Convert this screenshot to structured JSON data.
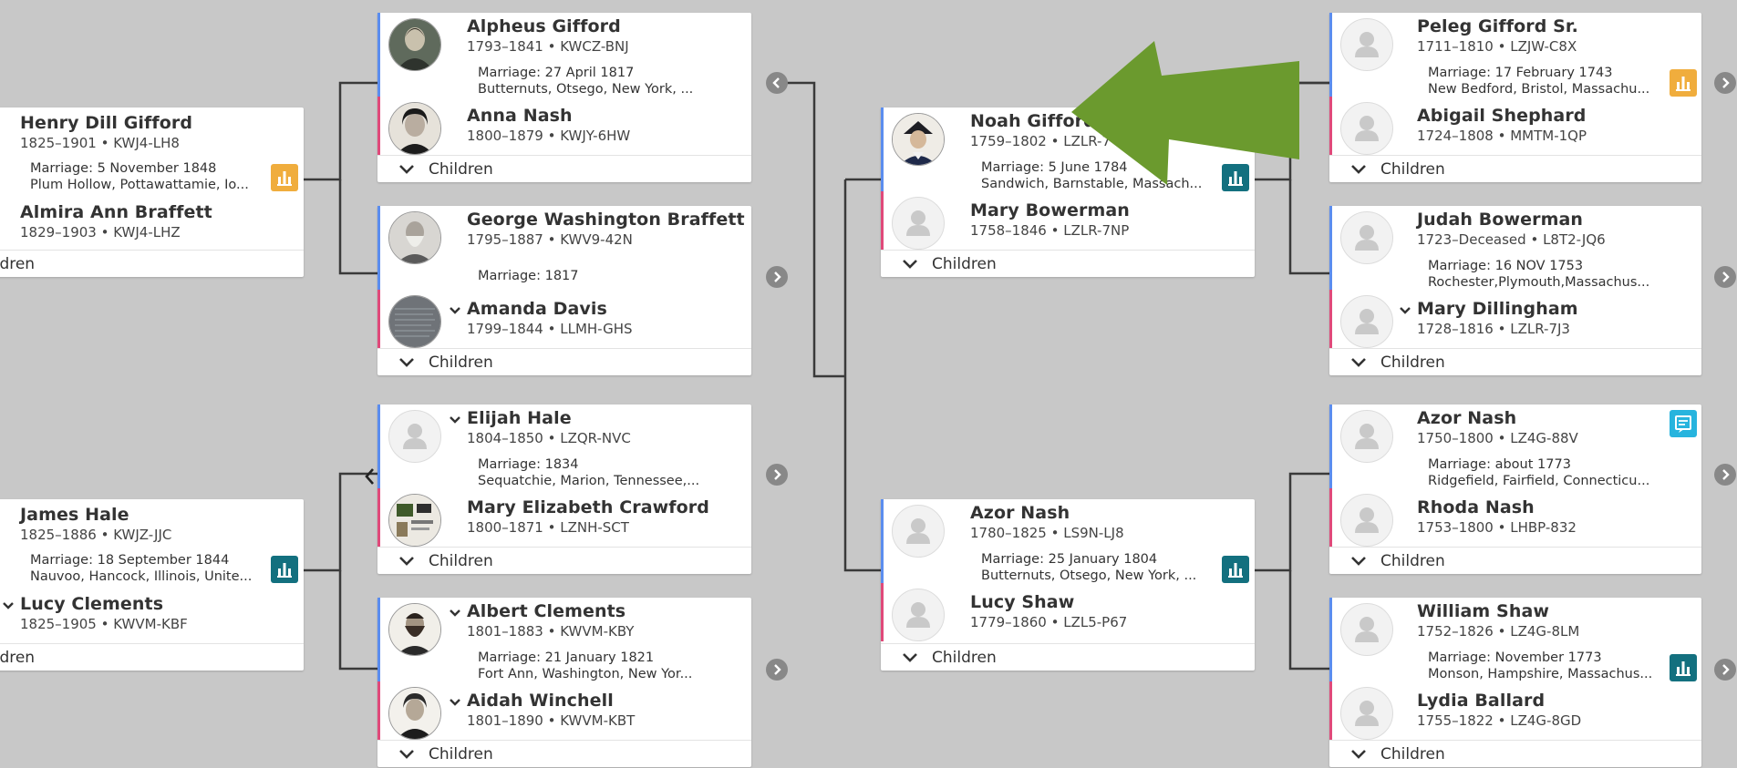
{
  "ui": {
    "children_label": "Children",
    "children_label_cut": "ildren"
  },
  "colors": {
    "background": "#c8c8c8",
    "male_bar": "#5b8def",
    "female_bar": "#e0497a",
    "temple_orange": "#f0ad3d",
    "temple_teal": "#13707f",
    "record_cyan": "#27b4de",
    "arrow_green": "#6b9a2e"
  },
  "couples": {
    "henry": {
      "husband": {
        "name": "Henry Dill Gifford",
        "dates": "1825–1901 • KWJ4-LH8",
        "icon": "person-placeholder-icon"
      },
      "marriage": "Marriage: 5 November 1848",
      "place": "Plum Hollow, Pottawattamie, Io...",
      "wife": {
        "name": "Almira Ann Braffett",
        "dates": "1829–1903 • KWJ4-LHZ",
        "icon": "person-placeholder-icon"
      },
      "badge": "temple-orange-icon"
    },
    "james": {
      "husband": {
        "name": "James Hale",
        "dates": "1825–1886 • KWJZ-JJC",
        "icon": "person-placeholder-icon"
      },
      "marriage": "Marriage: 18 September 1844",
      "place": "Nauvoo, Hancock, Illinois, Unite...",
      "wife": {
        "name": "Lucy Clements",
        "dates": "1825–1905 • KWVM-KBF",
        "icon": "person-placeholder-icon"
      },
      "badge": "temple-teal-icon"
    },
    "alpheus": {
      "husband": {
        "name": "Alpheus Gifford",
        "dates": "1793–1841 • KWCZ-BNJ",
        "icon": "portrait-photo-icon"
      },
      "marriage": "Marriage: 27 April 1817",
      "place": "Butternuts, Otsego, New York, ...",
      "wife": {
        "name": "Anna Nash",
        "dates": "1800–1879 • KWJY-6HW",
        "icon": "portrait-photo-icon"
      }
    },
    "george": {
      "husband": {
        "name": "George Washington Braffett",
        "dates": "1795–1887 • KWV9-42N",
        "icon": "portrait-photo-icon"
      },
      "marriage": "Marriage: 1817",
      "place": "",
      "wife": {
        "name": "Amanda Davis",
        "dates": "1799–1844 • LLMH-GHS",
        "icon": "document-photo-icon"
      }
    },
    "elijah": {
      "husband": {
        "name": "Elijah Hale",
        "dates": "1804–1850 • LZQR-NVC",
        "icon": "person-placeholder-icon"
      },
      "marriage": "Marriage: 1834",
      "place": "Sequatchie, Marion, Tennessee,...",
      "wife": {
        "name": "Mary Elizabeth Crawford",
        "dates": "1800–1871 • LZNH-SCT",
        "icon": "document-photo-icon"
      }
    },
    "albert": {
      "husband": {
        "name": "Albert Clements",
        "dates": "1801–1883 • KWVM-KBY",
        "icon": "portrait-photo-icon"
      },
      "marriage": "Marriage: 21 January 1821",
      "place": "Fort Ann, Washington, New Yor...",
      "wife": {
        "name": "Aidah Winchell",
        "dates": "1801–1890 • KWVM-KBT",
        "icon": "portrait-photo-icon"
      }
    },
    "noah": {
      "husband": {
        "name": "Noah Gifford",
        "dates": "1759–1802 • LZLR-7",
        "icon": "portrait-photo-icon"
      },
      "marriage": "Marriage: 5 June 1784",
      "place": "Sandwich, Barnstable, Massach...",
      "wife": {
        "name": "Mary Bowerman",
        "dates": "1758–1846 • LZLR-7NP",
        "icon": "person-placeholder-icon"
      },
      "badge": "temple-teal-icon"
    },
    "azor1780": {
      "husband": {
        "name": "Azor Nash",
        "dates": "1780–1825 • LS9N-LJ8",
        "icon": "person-placeholder-icon"
      },
      "marriage": "Marriage: 25 January 1804",
      "place": "Butternuts, Otsego, New York, ...",
      "wife": {
        "name": "Lucy Shaw",
        "dates": "1779–1860 • LZL5-P67",
        "icon": "person-placeholder-icon"
      },
      "badge": "temple-teal-icon"
    },
    "peleg": {
      "husband": {
        "name": "Peleg Gifford Sr.",
        "dates": "1711–1810 • LZJW-C8X",
        "icon": "person-placeholder-icon"
      },
      "marriage": "Marriage: 17 February 1743",
      "place": "New Bedford, Bristol, Massachu...",
      "wife": {
        "name": "Abigail Shephard",
        "dates": "1724–1808 • MMTM-1QP",
        "icon": "person-placeholder-icon"
      },
      "badge": "temple-orange-icon"
    },
    "judah": {
      "husband": {
        "name": "Judah Bowerman",
        "dates": "1723–Deceased • L8T2-JQ6",
        "icon": "person-placeholder-icon"
      },
      "marriage": "Marriage: 16 NOV 1753",
      "place": "Rochester,Plymouth,Massachus...",
      "wife": {
        "name": "Mary Dillingham",
        "dates": "1728–1816 • LZLR-7J3",
        "icon": "person-placeholder-icon"
      }
    },
    "azor1750": {
      "husband": {
        "name": "Azor Nash",
        "dates": "1750–1800 • LZ4G-88V",
        "icon": "person-placeholder-icon"
      },
      "marriage": "Marriage: about 1773",
      "place": "Ridgefield, Fairfield, Connecticu...",
      "wife": {
        "name": "Rhoda Nash",
        "dates": "1753–1800 • LHBP-832",
        "icon": "person-placeholder-icon"
      },
      "badge": "record-hint-icon"
    },
    "william": {
      "husband": {
        "name": "William Shaw",
        "dates": "1752–1826 • LZ4G-8LM",
        "icon": "person-placeholder-icon"
      },
      "marriage": "Marriage: November 1773",
      "place": "Monson, Hampshire, Massachus...",
      "wife": {
        "name": "Lydia Ballard",
        "dates": "1755–1822 • LZ4G-8GD",
        "icon": "person-placeholder-icon"
      },
      "badge": "temple-teal-icon"
    }
  }
}
